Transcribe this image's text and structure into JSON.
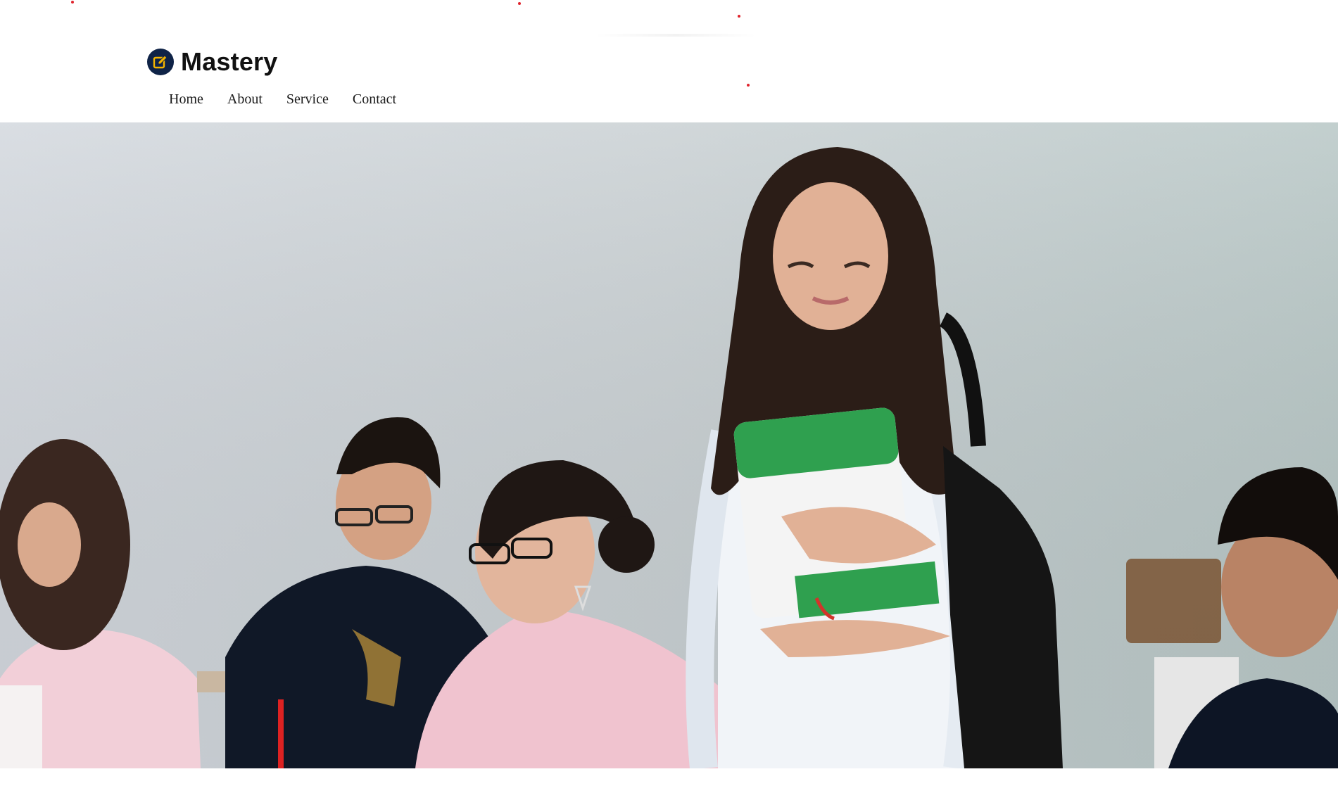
{
  "brand": {
    "name": "Mastery",
    "icon": "edit-icon",
    "icon_bg": "#0f2347",
    "icon_fg": "#f4b400"
  },
  "nav": {
    "items": [
      {
        "label": "Home"
      },
      {
        "label": "About"
      },
      {
        "label": "Service"
      },
      {
        "label": "Contact"
      }
    ]
  },
  "hero": {
    "image": "students-in-classroom-photo"
  },
  "colors": {
    "accent_dot": "#e0242d",
    "text": "#1a1a1a"
  }
}
